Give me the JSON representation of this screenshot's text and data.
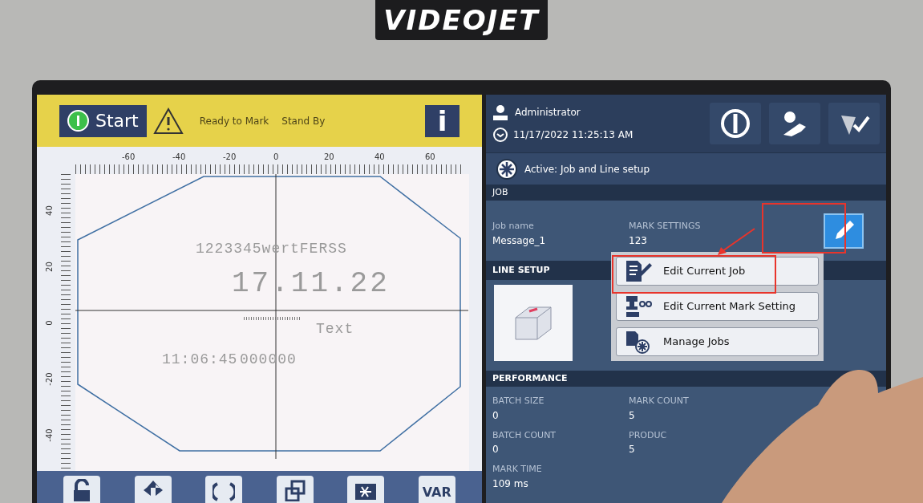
{
  "device": {
    "brand": "VIDEOJET"
  },
  "status_bar": {
    "start_button": "Start",
    "messages": [
      "Ready to Mark",
      "Stand By"
    ],
    "info_button": "i"
  },
  "ruler": {
    "x_ticks": [
      "-60",
      "-40",
      "-20",
      "0",
      "20",
      "40",
      "60"
    ],
    "y_ticks": [
      "40",
      "20",
      "0",
      "-20",
      "-40"
    ]
  },
  "canvas": {
    "items": [
      {
        "kind": "text",
        "text": "1223345wertFERSS"
      },
      {
        "kind": "date",
        "text": "17.11.22"
      },
      {
        "kind": "text",
        "text": "Text"
      },
      {
        "kind": "text",
        "text": "11:06:45"
      },
      {
        "kind": "text",
        "text": "000000"
      }
    ]
  },
  "toolbar": {
    "var_button": "VAR"
  },
  "header": {
    "user": "Administrator",
    "datetime": "11/17/2022 11:25:13 AM",
    "active": "Active: Job and Line setup"
  },
  "job": {
    "heading": "JOB",
    "fields": [
      {
        "label": "Job name",
        "value": "Message_1"
      },
      {
        "label": "MARK SETTINGS",
        "value": "123"
      }
    ],
    "edit_highlighted": true
  },
  "line_setup": {
    "heading": "LINE SETUP"
  },
  "performance": {
    "heading": "PERFORMANCE",
    "fields": [
      {
        "label": "BATCH SIZE",
        "value": "0"
      },
      {
        "label": "MARK COUNT",
        "value": "5"
      },
      {
        "label": "BATCH COUNT",
        "value": "0"
      },
      {
        "label": "PRODUC",
        "value": "5"
      },
      {
        "label": "MARK TIME",
        "value": "109 ms"
      }
    ]
  },
  "popup_menu": {
    "items": [
      {
        "label": "Edit Current Job",
        "highlighted": true
      },
      {
        "label": "Edit Current Mark Setting",
        "highlighted": false
      },
      {
        "label": "Manage Jobs",
        "highlighted": false
      }
    ]
  }
}
